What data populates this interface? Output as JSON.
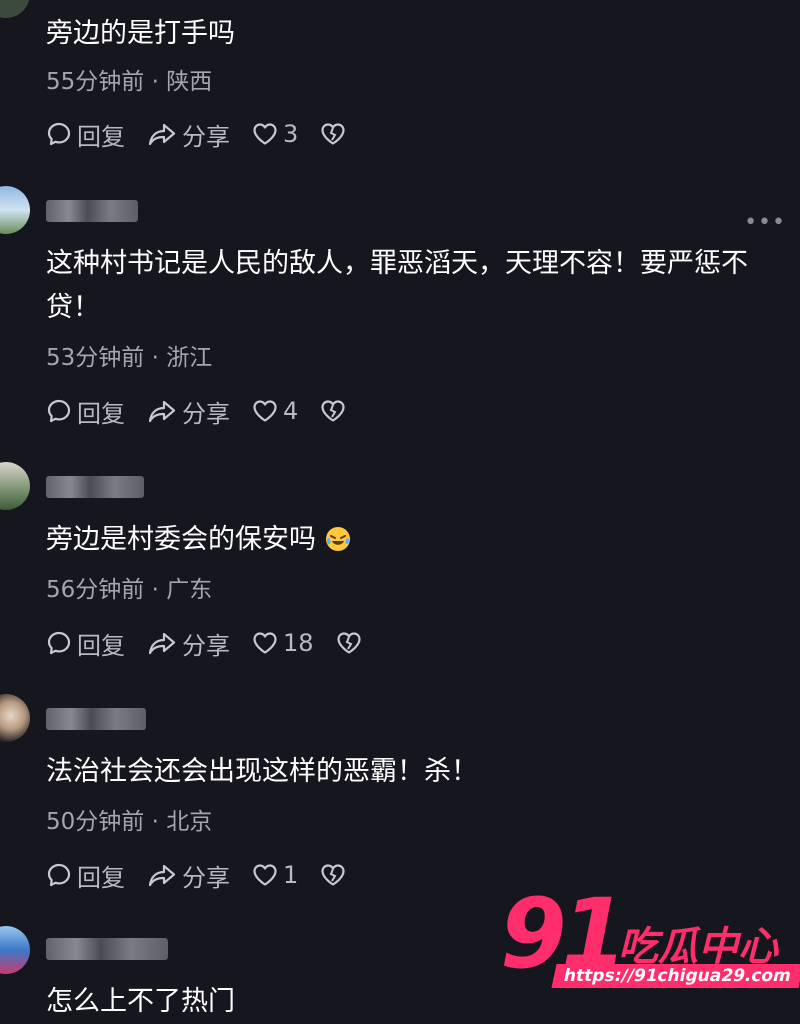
{
  "comments": [
    {
      "text": "旁边的是打手吗",
      "meta": "55分钟前 · 陕西",
      "reply_label": "回复",
      "share_label": "分享",
      "likes": "3"
    },
    {
      "text": "这种村书记是人民的敌人，罪恶滔天，天理不容！要严惩不贷！",
      "meta": "53分钟前 · 浙江",
      "reply_label": "回复",
      "share_label": "分享",
      "likes": "4"
    },
    {
      "text": "旁边是村委会的保安吗",
      "emoji": "laughing-crying-emoji",
      "meta": "56分钟前 · 广东",
      "reply_label": "回复",
      "share_label": "分享",
      "likes": "18"
    },
    {
      "text": "法治社会还会出现这样的恶霸！杀！",
      "meta": "50分钟前 · 北京",
      "reply_label": "回复",
      "share_label": "分享",
      "likes": "1"
    },
    {
      "text": "怎么上不了热门"
    }
  ],
  "icons": {
    "reply": "comment-bubble-icon",
    "share": "share-arrow-icon",
    "like": "heart-icon",
    "dislike": "broken-heart-icon",
    "more": "more-dots-icon"
  },
  "watermark": {
    "number": "91",
    "brand": "吃瓜中心",
    "url": "https://91chigua29.com"
  },
  "colors": {
    "background": "#16161e",
    "text": "#ffffff",
    "meta": "#a5a5ad",
    "watermark": "#ff2d6b"
  }
}
